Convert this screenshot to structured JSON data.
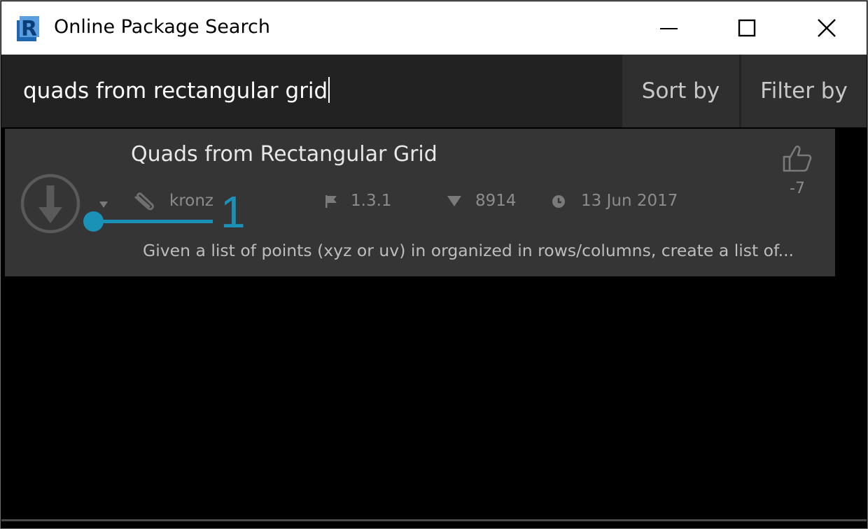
{
  "window": {
    "title": "Online Package Search",
    "app_icon": "revit-r-icon",
    "controls": [
      "minimize-icon",
      "maximize-icon",
      "close-icon"
    ]
  },
  "search": {
    "value": "quads from rectangular grid"
  },
  "toolbar": {
    "sort_label": "Sort by",
    "filter_label": "Filter by"
  },
  "results": [
    {
      "title": "Quads from Rectangular Grid",
      "author": "kronz",
      "version": "1.3.1",
      "downloads": "8914",
      "date": "13 Jun 2017",
      "votes": "-7",
      "description": "Given a list of points (xyz or uv) in organized in rows/columns, create a list of..."
    }
  ],
  "callout": {
    "label": "1",
    "color": "#1a91b7"
  },
  "colors": {
    "accent": "#1a91b7",
    "background": "#000000",
    "toolbar": "#222222",
    "card": "#353535"
  }
}
